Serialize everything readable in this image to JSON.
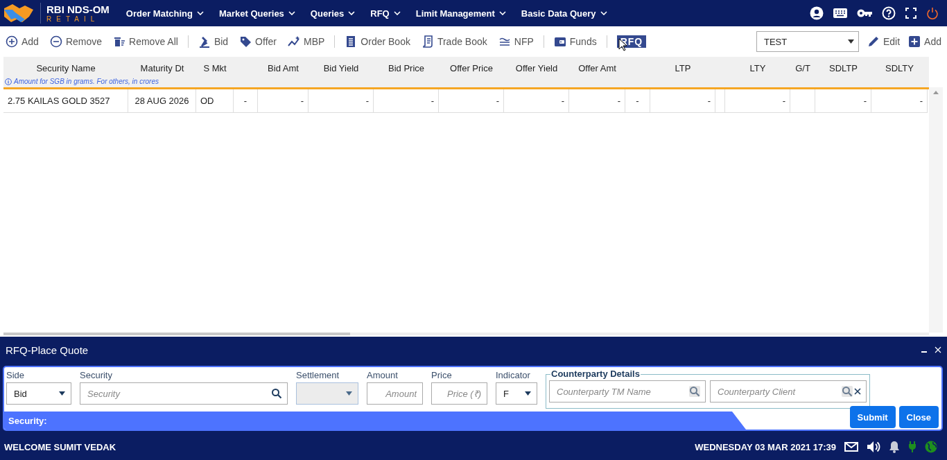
{
  "app": {
    "title": "RBI NDS-OM",
    "subtitle": "RETAIL"
  },
  "nav": {
    "menus": [
      {
        "label": "Order Matching"
      },
      {
        "label": "Market Queries"
      },
      {
        "label": "Queries"
      },
      {
        "label": "RFQ"
      },
      {
        "label": "Limit Management"
      },
      {
        "label": "Basic Data Query"
      }
    ]
  },
  "toolbar": {
    "groups": [
      [
        {
          "label": "Add",
          "hovered": false
        },
        {
          "label": "Remove",
          "hovered": false
        },
        {
          "label": "Remove All",
          "hovered": false
        }
      ],
      [
        {
          "label": "Bid",
          "hovered": false
        },
        {
          "label": "Offer",
          "hovered": false
        },
        {
          "label": "MBP",
          "hovered": false
        }
      ],
      [
        {
          "label": "Order Book",
          "hovered": false
        },
        {
          "label": "Trade Book",
          "hovered": false
        },
        {
          "label": "NFP",
          "hovered": false
        }
      ],
      [
        {
          "label": "Funds",
          "hovered": false
        }
      ],
      [
        {
          "label": "RFQ",
          "hovered": true
        }
      ]
    ],
    "profile": {
      "value": "TEST"
    },
    "actions": [
      "Edit",
      "Add"
    ]
  },
  "table": {
    "note": "Amount for SGB in grams. For others, in crores",
    "columns": [
      {
        "label": "Security Name",
        "kind": "text"
      },
      {
        "label": "Maturity Dt",
        "kind": "center"
      },
      {
        "label": "S Mkt",
        "kind": "text"
      },
      {
        "kind": "spacer"
      },
      {
        "label": "Bid Amt",
        "kind": "number"
      },
      {
        "label": "Bid Yield",
        "kind": "number"
      },
      {
        "label": "Bid Price",
        "kind": "number"
      },
      {
        "label": "Offer Price",
        "kind": "number"
      },
      {
        "label": "Offer Yield",
        "kind": "number"
      },
      {
        "label": "Offer Amt",
        "kind": "number"
      },
      {
        "kind": "spacer"
      },
      {
        "label": "LTP",
        "kind": "number"
      },
      {
        "kind": "spacer"
      },
      {
        "label": "LTY",
        "kind": "number"
      },
      {
        "label": "G/T",
        "kind": "number"
      },
      {
        "label": "SDLTP",
        "kind": "number"
      },
      {
        "label": "SDLTY",
        "kind": "number"
      }
    ],
    "rows": [
      {
        "cells": [
          "2.75 KAILAS GOLD 3527",
          "28 AUG 2026",
          "OD",
          "-",
          "-",
          "-",
          "-",
          "-",
          "-",
          "-",
          "-",
          "-",
          null,
          "-",
          null,
          "-",
          "-"
        ]
      }
    ]
  },
  "quote_panel": {
    "title": "RFQ-Place Quote",
    "fields": [
      {
        "kind": "select",
        "label": "Side",
        "value": "Bid",
        "disabled": false
      },
      {
        "kind": "search",
        "label": "Security",
        "placeholder": "Security"
      },
      {
        "kind": "select",
        "label": "Settlement",
        "disabled": true
      },
      {
        "kind": "input",
        "label": "Amount",
        "placeholder": "Amount"
      },
      {
        "kind": "input",
        "label": "Price",
        "placeholder": "Price (₹)"
      },
      {
        "kind": "select",
        "label": "Indicator",
        "value": "F",
        "disabled": false
      }
    ],
    "counterparty": {
      "legend": "Counterparty Details",
      "fields": [
        {
          "placeholder": "Counterparty TM Name",
          "clearable": false
        },
        {
          "placeholder": "Counterparty Client",
          "clearable": true
        }
      ]
    },
    "security_label": "Security:",
    "buttons": [
      "Submit",
      "Close"
    ]
  },
  "status_bar": {
    "welcome": "WELCOME SUMIT VEDAK",
    "datetime": "WEDNESDAY 03 MAR 2021 17:39"
  }
}
